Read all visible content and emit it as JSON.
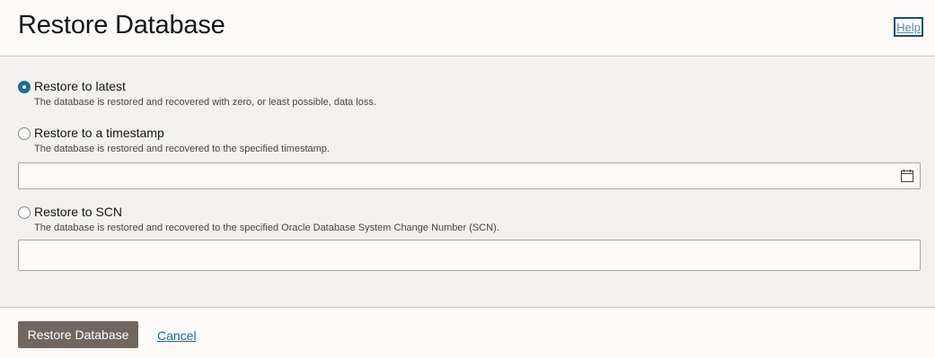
{
  "header": {
    "title": "Restore Database",
    "help_label": "Help"
  },
  "options": [
    {
      "label": "Restore to latest",
      "description": "The database is restored and recovered with zero, or least possible, data loss.",
      "selected": true
    },
    {
      "label": "Restore to a timestamp",
      "description": "The database is restored and recovered to the specified timestamp.",
      "selected": false
    },
    {
      "label": "Restore to SCN",
      "description": "The database is restored and recovered to the specified Oracle Database System Change Number (SCN).",
      "selected": false
    }
  ],
  "fields": {
    "timestamp_value": "",
    "scn_value": ""
  },
  "footer": {
    "primary_label": "Restore Database",
    "cancel_label": "Cancel"
  },
  "colors": {
    "accent": "#1f6a93",
    "primary_button": "#6f6760",
    "panel_bg": "#f2f1ef"
  },
  "icons": {
    "calendar": "calendar-icon"
  }
}
